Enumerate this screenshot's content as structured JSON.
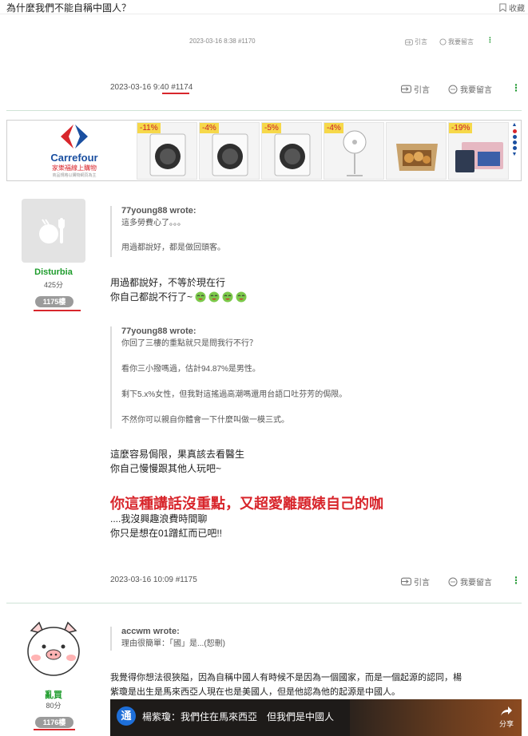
{
  "page": {
    "title": "為什麼我們不能自稱中國人？",
    "favorite_label": "收藏"
  },
  "post_prev": {
    "meta": "2023-03-16 8:38 #1170",
    "quote_label": "引言",
    "reply_label": "我要留言"
  },
  "post_1174": {
    "date": "2023-03-16 9:40",
    "floor_no": "#1174",
    "quote_label": "引言",
    "reply_label": "我要留言"
  },
  "ad": {
    "brand": "Carrefour",
    "brand_sub": "家樂福線上購物",
    "brand_tiny": "商品規格以購物網頁為主",
    "products": [
      {
        "discount": "-11%",
        "icon": "washing-machine-icon"
      },
      {
        "discount": "-4%",
        "icon": "washing-machine-icon"
      },
      {
        "discount": "-5%",
        "icon": "washing-machine-icon"
      },
      {
        "discount": "-4%",
        "icon": "fan-icon"
      },
      {
        "discount": "",
        "icon": "food-box-icon"
      },
      {
        "discount": "-19%",
        "icon": "tablet-icon"
      }
    ]
  },
  "post_1175": {
    "username": "Disturbia",
    "points": "425分",
    "floor": "1175樓",
    "quote1_author": "77young88 wrote:",
    "quote1_lines": [
      "這多勞費心了。。。",
      "用過都說好，都是做回頭客。"
    ],
    "body1_lines": [
      "用過都說好，不等於現在行",
      "你自己都說不行了~"
    ],
    "quote2_author": "77young88 wrote:",
    "quote2_lines": [
      "你回了三樓的重點就只是問我行不行？",
      "看你三小撥嗎過，估計94.87%是男性。",
      "剩下5.x%女性，但我對這搖過高潮嗎還用台語口吐芬芳的侷限。",
      "不然你可以親自你體會一下什麼叫做一模三式。"
    ],
    "body2_lines": [
      "這麼容易侷限，果真該去看醫生",
      "你自己慢慢跟其他人玩吧~"
    ],
    "big_red": "你這種講話沒重點，又超愛離題婊自己的咖",
    "body3_lines": [
      "....我沒興趣浪費時間聊",
      "你只是想在01蹭紅而已吧!!"
    ],
    "date": "2023-03-16 10:09 #1175",
    "quote_label": "引言",
    "reply_label": "我要留言"
  },
  "post_1176": {
    "username": "亂買",
    "points": "80分",
    "floor": "1176樓",
    "quote_author": "accwm wrote:",
    "quote_line": "理由很簡單：「國」是...(恕刪)",
    "body_lines": [
      "我覺得你想法很狹隘，因為自稱中國人有時候不是因為一個國家，而是一個起源的認同，楊",
      "紫瓊是出生是馬來西亞人現在也是美國人，但是他認為他的起源是中國人。"
    ],
    "video_channel": "通",
    "video_title": "楊紫瓊：我們住在馬來西亞　但我們是中國人",
    "video_share": "分享"
  },
  "colors": {
    "accent_green": "#1e9c2c",
    "highlight_red": "#d8262c",
    "floor_badge": "#9b9b9b"
  }
}
